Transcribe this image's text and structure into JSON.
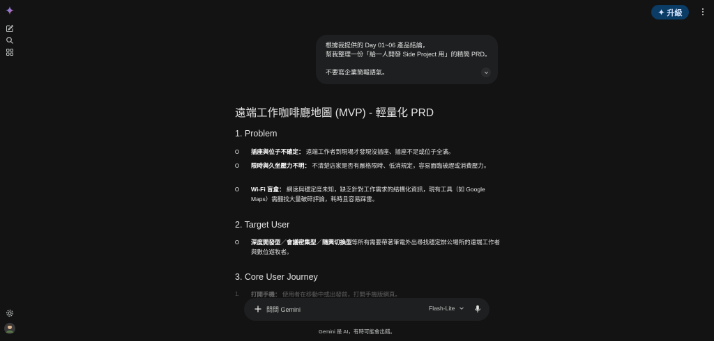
{
  "header": {
    "upgrade_label": "升級"
  },
  "user_message": {
    "line1": "根據我提供的 Day 01~06 產品結論，",
    "line2": "幫我整理一份「給一人開發 Side Project 用」的精簡 PRD。",
    "line3": "不要寫企業簡報語氣。"
  },
  "response": {
    "title": "遠端工作咖啡廳地圖 (MVP) - 輕量化 PRD",
    "sections": [
      {
        "heading": "1. Problem",
        "items": [
          {
            "bold": "插座與位子不確定：",
            "text": "遠端工作者到現場才發現沒插座、插座不足或位子全滿。"
          },
          {
            "bold": "限時與久坐壓力不明：",
            "text": "不清楚店家是否有嚴格限時、低消規定，容易面臨被趕或消費壓力。"
          },
          {
            "bold": "Wi-Fi 盲盒：",
            "text": "網速與穩定度未知，缺乏針對工作需求的結構化資訊，現有工具（如 Google Maps）需翻找大量破碎評論，耗時且容易踩雷。"
          }
        ]
      },
      {
        "heading": "2. Target User",
        "items": [
          {
            "bold_parts": [
              "深度開發型",
              "／",
              "會議密集型",
              "／",
              "隨興切換型"
            ],
            "text": "等所有需要帶著筆電外出尋找穩定辦公場所的遠端工作者與數位遊牧者。"
          }
        ]
      },
      {
        "heading": "3. Core User Journey",
        "items": [
          {
            "marker": "1.",
            "bold": "打開手機：",
            "text": "使用者在移動中或出發前，打開手機版網頁。"
          }
        ]
      }
    ]
  },
  "input": {
    "placeholder": "問問 Gemini",
    "model": "Flash-Lite"
  },
  "footer": {
    "disclaimer": "Gemini 是 AI，有時可能會出錯。"
  },
  "colors": {
    "background": "#131314",
    "surface": "#1e1f20",
    "upgrade_bg": "#0b3c66",
    "text": "#e3e3e3"
  }
}
